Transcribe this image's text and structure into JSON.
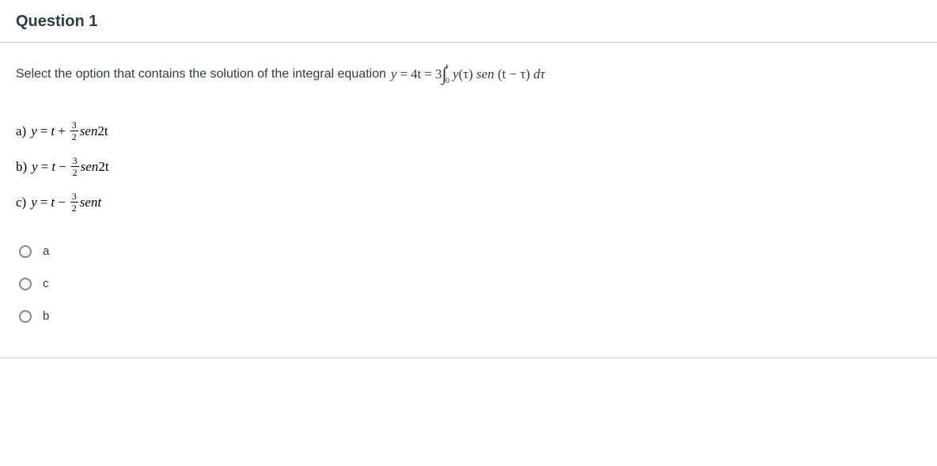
{
  "question": {
    "title": "Question 1",
    "prompt_text": "Select the option that contains the solution of the integral equation",
    "equation": {
      "lhs": "y",
      "eq1": "=",
      "mid": "4t",
      "eq2": "=",
      "coef": "3",
      "int_lower": "0",
      "int_upper": "t",
      "integrand_y": "y",
      "integrand_arg1": "(τ)",
      "integrand_fn": "sen",
      "integrand_arg2": "(t − τ)",
      "dtau": "dτ"
    }
  },
  "options_math": {
    "a": {
      "label": "a)",
      "y": "y",
      "eq": "=",
      "t": "t",
      "op": "+",
      "frac_num": "3",
      "frac_den": "2",
      "fn": "sen",
      "arg": "2t"
    },
    "b": {
      "label": "b)",
      "y": "y",
      "eq": "=",
      "t": "t",
      "op": "−",
      "frac_num": "3",
      "frac_den": "2",
      "fn": "sen",
      "arg": "2t"
    },
    "c": {
      "label": "c)",
      "y": "y",
      "eq": "=",
      "t": "t",
      "op": "−",
      "frac_num": "3",
      "frac_den": "2",
      "fn": "sen",
      "arg": "t"
    }
  },
  "radios": {
    "a": "a",
    "c": "c",
    "b": "b"
  }
}
